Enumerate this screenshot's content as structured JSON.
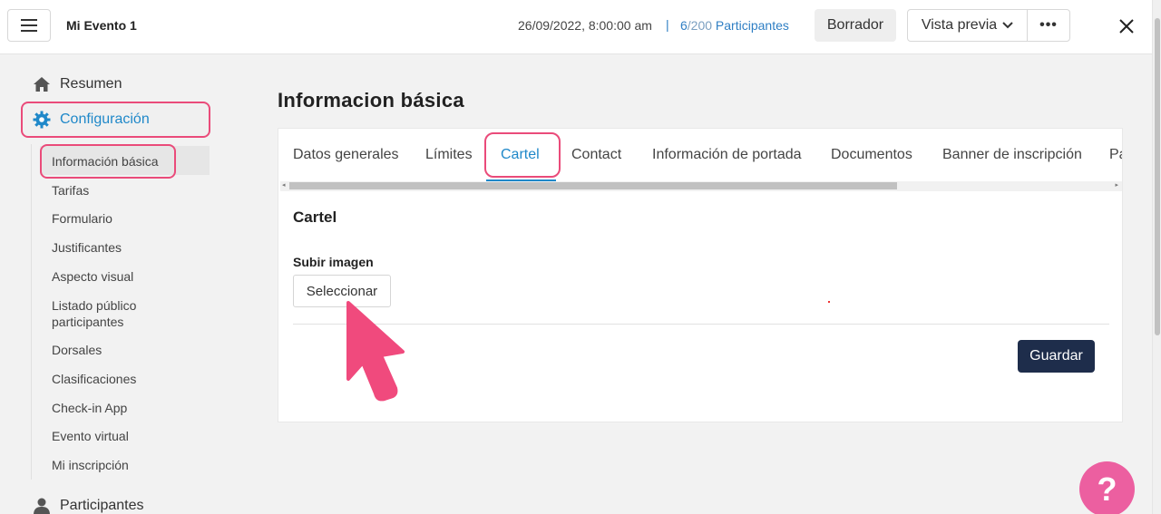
{
  "header": {
    "event_title": "Mi Evento 1",
    "datetime": "26/09/2022, 8:00:00 am",
    "separator": "|",
    "participants_count": "6",
    "participants_total": "/200",
    "participants_label": " Participantes",
    "draft_label": "Borrador",
    "preview_label": "Vista previa",
    "more_label": "•••"
  },
  "sidebar": {
    "summary_label": "Resumen",
    "config_label": "Configuración",
    "participants_label": "Participantes",
    "sub_items": [
      "Información básica",
      "Tarifas",
      "Formulario",
      "Justificantes",
      "Aspecto visual",
      "Listado público participantes",
      "Dorsales",
      "Clasificaciones",
      "Check-in App",
      "Evento virtual",
      "Mi inscripción"
    ]
  },
  "main": {
    "title": "Informacion básica",
    "tabs": [
      "Datos generales",
      "Límites",
      "Cartel",
      "Contact",
      "Información de portada",
      "Documentos",
      "Banner de inscripción",
      "Pa"
    ],
    "active_tab": "Cartel",
    "section_title": "Cartel",
    "upload_label": "Subir imagen",
    "select_button": "Seleccionar",
    "save_button": "Guardar"
  },
  "help": {
    "label": "?"
  },
  "colors": {
    "accent": "#1f88c9",
    "highlight": "#ea4b7a",
    "save_bg": "#1e2d4b",
    "help_bg": "#ec5fa0"
  },
  "icons": {
    "menu": "hamburger-icon",
    "close": "close-icon",
    "summary": "home-icon",
    "config": "gear-icon",
    "participants": "user-icon",
    "chevron": "chevron-down-icon"
  }
}
